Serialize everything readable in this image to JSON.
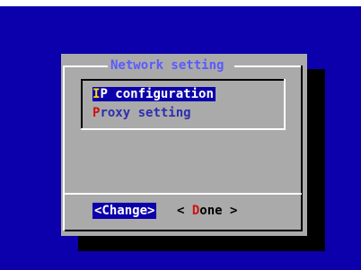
{
  "dialog": {
    "title": "Network setting",
    "menu": {
      "items": [
        {
          "hotkey": "I",
          "rest": "P configuration",
          "selected": true
        },
        {
          "hotkey": "P",
          "rest": "roxy setting",
          "selected": false
        }
      ]
    },
    "buttons": {
      "change": {
        "label": "<Change>"
      },
      "done": {
        "prefix": "< ",
        "hotkey": "D",
        "rest": "one >"
      }
    }
  },
  "colors": {
    "screen_background": "#0b00ab",
    "dialog_background": "#aaaaaa",
    "title_text": "#5a5aff",
    "hotkey_selected": "#ffdd00",
    "hotkey_unselected": "#d01010"
  }
}
